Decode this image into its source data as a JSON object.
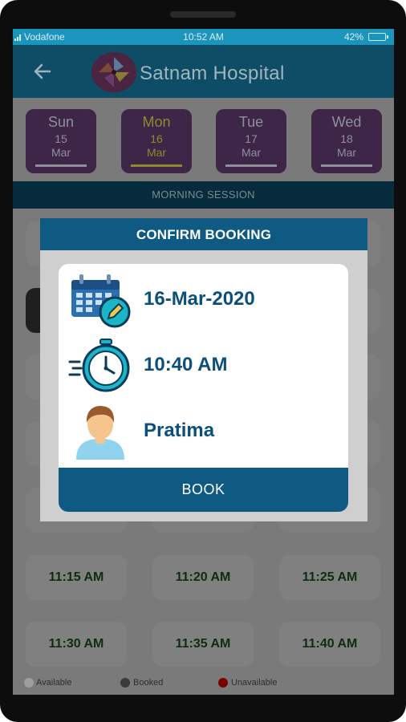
{
  "status_bar": {
    "carrier": "Vodafone",
    "time": "10:52 AM",
    "battery": "42%"
  },
  "app_bar": {
    "title": "Satnam Hospital",
    "back_icon": "arrow-left-icon",
    "logo_icon": "pinwheel-logo-icon"
  },
  "days": [
    {
      "name": "Sun",
      "day": "15",
      "month": "Mar",
      "selected": false
    },
    {
      "name": "Mon",
      "day": "16",
      "month": "Mar",
      "selected": true
    },
    {
      "name": "Tue",
      "day": "17",
      "month": "Mar",
      "selected": false
    },
    {
      "name": "Wed",
      "day": "18",
      "month": "Mar",
      "selected": false
    }
  ],
  "session_label": "MORNING SESSION",
  "slots": [
    {
      "time": "11:15 AM"
    },
    {
      "time": "11:20 AM"
    },
    {
      "time": "11:25 AM"
    },
    {
      "time": "11:30 AM"
    },
    {
      "time": "11:35 AM"
    },
    {
      "time": "11:40 AM"
    }
  ],
  "legend": {
    "available": "Available",
    "booked": "Booked",
    "unavailable": "Unavailable",
    "colors": {
      "available": "#9e9e9e",
      "booked": "#3a3a3a",
      "unavailable": "#7a0000"
    }
  },
  "dialog": {
    "title": "CONFIRM BOOKING",
    "date": "16-Mar-2020",
    "time": "10:40 AM",
    "patient": "Pratima",
    "book_label": "BOOK",
    "icons": [
      "calendar-edit-icon",
      "stopwatch-icon",
      "person-avatar-icon"
    ]
  },
  "colors": {
    "primary": "#0f5a82",
    "accent_text": "#0c4f7a",
    "status_bar": "#1c95bc"
  }
}
